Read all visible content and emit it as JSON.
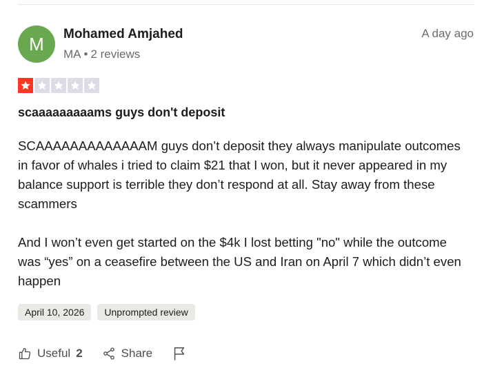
{
  "review": {
    "avatar_initial": "M",
    "author": "Mohamed Amjahed",
    "country": "MA",
    "separator": "•",
    "reviews_count": "2 reviews",
    "posted_relative": "A day ago",
    "rating": 1,
    "rating_max": 5,
    "title": "scaaaaaaaaams guys don't deposit",
    "body_paragraph_1": "SCAAAAAAAAAAAAAM guys don’t deposit they always manipulate outcomes in favor of whales i tried to claim $21 that I won, but it never appeared in my balance support is terrible they don’t respond at all. Stay away from these scammers",
    "body_paragraph_2": "And I won’t even get started on the $4k I lost betting \"no\" while the outcome was “yes” on a ceasefire between the US and Iran on April 7 which didn’t even happen",
    "date_tag": "April 10, 2026",
    "type_tag": "Unprompted review"
  },
  "actions": {
    "useful_label": "Useful",
    "useful_count": "2",
    "share_label": "Share"
  },
  "colors": {
    "avatar": "#6aa84f",
    "star_filled": "#ff3722",
    "star_empty": "#dcdce6"
  },
  "icons": {
    "useful": "thumbs-up-icon",
    "share": "share-icon",
    "report": "flag-icon",
    "star": "star-icon"
  }
}
